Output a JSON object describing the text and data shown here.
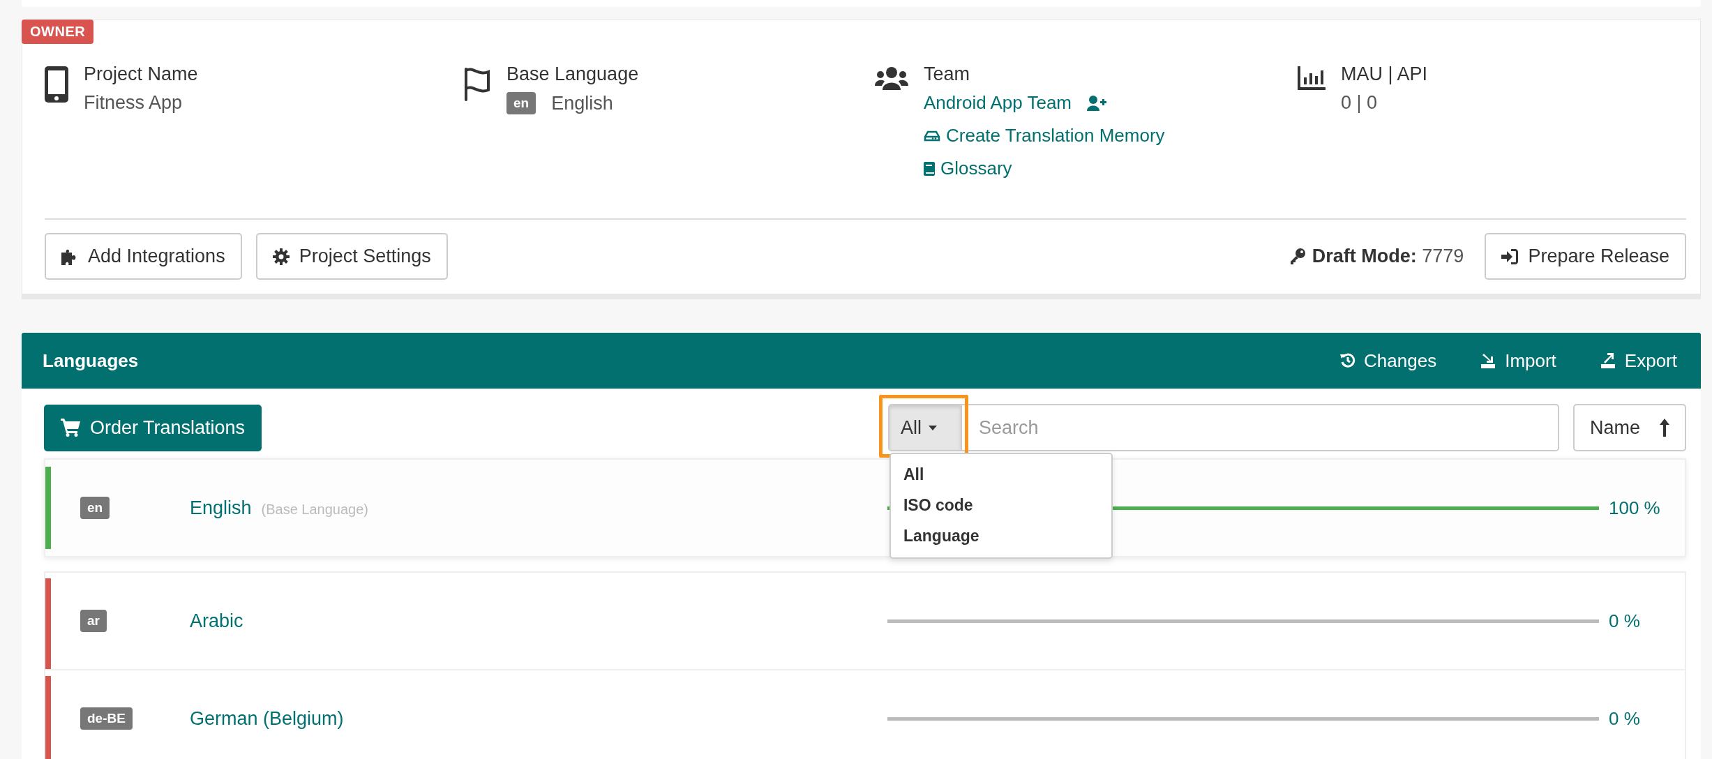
{
  "project": {
    "owner_badge": "OWNER",
    "fields": [
      {
        "kind": "phone",
        "label": "Project Name",
        "value": "Fitness App"
      },
      {
        "kind": "language",
        "label": "Base Language",
        "code": "en",
        "value": "English"
      },
      {
        "kind": "team",
        "label": "Team",
        "value": "Android App Team",
        "links": [
          "Create Translation Memory",
          "Glossary"
        ]
      },
      {
        "kind": "chart",
        "label": "MAU | API",
        "value": "0 | 0"
      }
    ],
    "buttons": [
      "Add Integrations",
      "Project Settings"
    ],
    "draft_label": "Draft Mode:",
    "draft_value": "7779",
    "release_button": "Prepare Release"
  },
  "languages": {
    "title": "Languages",
    "actions": [
      "Changes",
      "Import",
      "Export"
    ],
    "order_button": "Order Translations",
    "filter": {
      "value": "All",
      "expanded": true,
      "highlighted": true,
      "options": [
        "All",
        "ISO code",
        "Language"
      ]
    },
    "search": {
      "placeholder": "Search"
    },
    "sort": {
      "label": "Name"
    },
    "rows": [
      {
        "code": "en",
        "name": "English",
        "note": "(Base Language)",
        "level": 1,
        "percent": "100 %",
        "color": "#4cae4c"
      },
      {
        "code": "ar",
        "name": "Arabic",
        "level": 0,
        "percent": "0 %",
        "color": "#d9534f"
      },
      {
        "code": "de-BE",
        "name": "German (Belgium)",
        "level": 0,
        "percent": "0 %",
        "color": "#d9534f"
      }
    ]
  }
}
